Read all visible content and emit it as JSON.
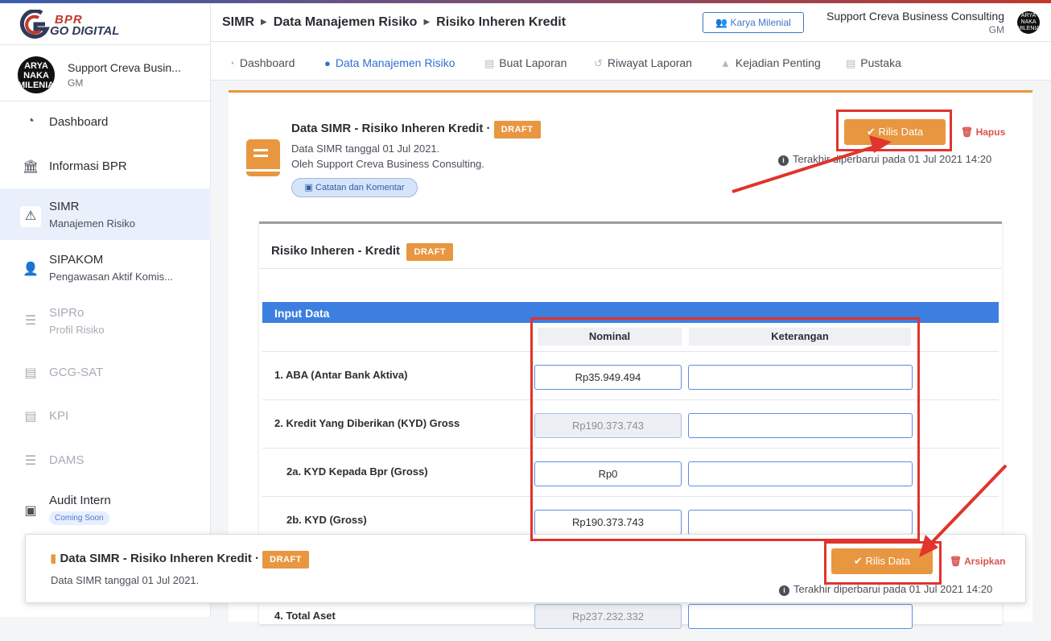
{
  "brand": {
    "line1": "BPR",
    "line2": "GO DIGITAL"
  },
  "user": {
    "name": "Support Creva Busin...",
    "role": "GM",
    "avatar_text": "ARYA NAKA MILENIAL"
  },
  "sidebar": {
    "items": [
      {
        "label": "Dashboard",
        "icon": "gauge-icon"
      },
      {
        "label": "Informasi BPR",
        "icon": "bank-icon"
      },
      {
        "label": "SIMR",
        "sub": "Manajemen Risiko",
        "icon": "warning-icon"
      },
      {
        "label": "SIPAKOM",
        "sub": "Pengawasan Aktif Komis...",
        "icon": "user-gear-icon"
      },
      {
        "label": "SIPRo",
        "sub": "Profil Risiko",
        "icon": "list-check-icon"
      },
      {
        "label": "GCG-SAT",
        "icon": "clipboard-icon"
      },
      {
        "label": "KPI",
        "icon": "clipboard-list-icon"
      },
      {
        "label": "DAMS",
        "icon": "list-check-icon"
      },
      {
        "label": "Audit Intern",
        "badge": "Coming Soon",
        "icon": "clipboard-check-icon"
      }
    ]
  },
  "header": {
    "breadcrumb": [
      "SIMR",
      "Data Manajemen Risiko",
      "Risiko Inheren Kredit"
    ],
    "karya_button": "Karya Milenial",
    "user_name": "Support Creva Business Consulting",
    "user_role": "GM",
    "avatar_text": "ARYA NAKA MILENIAL"
  },
  "tabs": [
    "Dashboard",
    "Data Manajemen Risiko",
    "Buat Laporan",
    "Riwayat Laporan",
    "Kejadian Penting",
    "Pustaka"
  ],
  "main": {
    "title": "Data SIMR - Risiko Inheren Kredit ·",
    "status": "DRAFT",
    "date_line": "Data SIMR tanggal 01 Jul 2021.",
    "by_line": "Oleh Support Creva Business Consulting.",
    "notes_button": "Catatan dan Komentar",
    "release_button": "Rilis Data",
    "delete_button": "Hapus",
    "updated": "Terakhir diperbarui pada 01 Jul 2021 14:20"
  },
  "form": {
    "title": "Risiko Inheren - Kredit",
    "status": "DRAFT",
    "section": "Input Data",
    "col_nominal": "Nominal",
    "col_keterangan": "Keterangan",
    "rows": [
      {
        "label": "1. ABA (Antar Bank Aktiva)",
        "value": "Rp35.949.494",
        "readonly": false
      },
      {
        "label": "2. Kredit Yang Diberikan (KYD) Gross",
        "value": "Rp190.373.743",
        "readonly": true
      },
      {
        "label": "2a. KYD Kepada Bpr (Gross)",
        "value": "Rp0",
        "readonly": false
      },
      {
        "label": "2b. KYD (Gross)",
        "value": "Rp190.373.743",
        "readonly": false
      },
      {
        "label": "4. Total Aset",
        "value": "Rp237.232.332",
        "readonly": true
      }
    ]
  },
  "sticky": {
    "title": "Data SIMR - Risiko Inheren Kredit ·",
    "status": "DRAFT",
    "date_line": "Data SIMR tanggal 01 Jul 2021.",
    "release_button": "Rilis Data",
    "archive_button": "Arsipkan",
    "updated": "Terakhir diperbarui pada 01 Jul 2021 14:20"
  },
  "colors": {
    "accent": "#e89740",
    "primary": "#3d7fe0",
    "danger": "#d9534f",
    "annotation": "#e0342c"
  }
}
